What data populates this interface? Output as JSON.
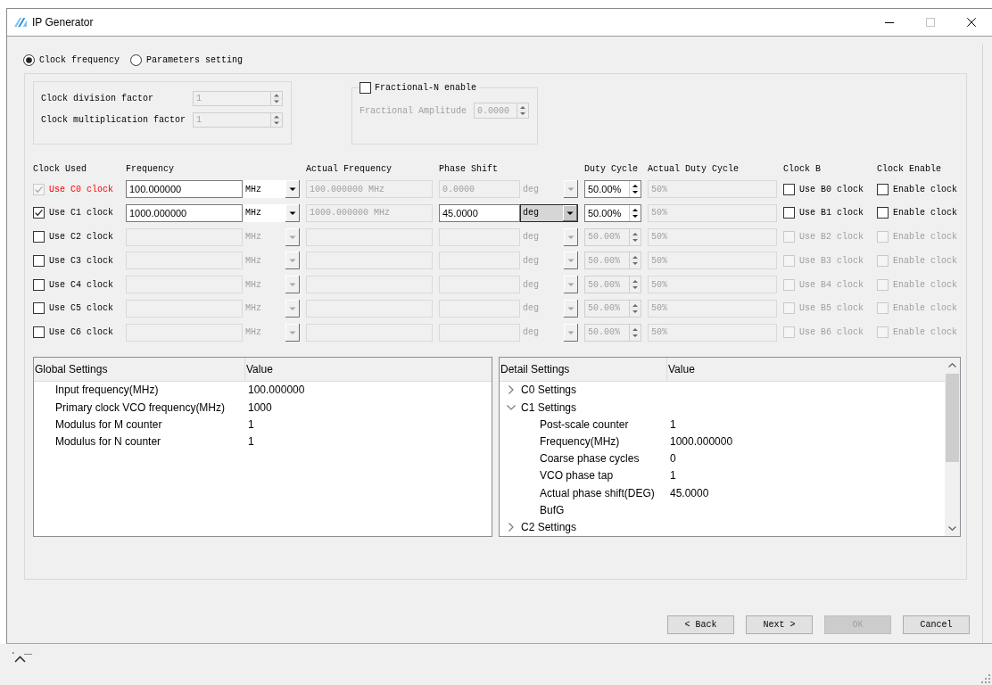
{
  "window": {
    "title": "IP Generator",
    "can_maximize": false
  },
  "mode_options": [
    {
      "label": "Clock frequency",
      "selected": true
    },
    {
      "label": "Parameters setting",
      "selected": false
    }
  ],
  "factor_group": {
    "fields": [
      {
        "label": "Clock division factor",
        "value": "1",
        "disabled": true
      },
      {
        "label": "Clock multiplication factor",
        "value": "1",
        "disabled": true
      }
    ]
  },
  "fractional_n": {
    "label": "Fractional-N enable",
    "checked": false,
    "amplitude": {
      "label": "Fractional Amplitude",
      "value": "0.0000",
      "disabled": true
    }
  },
  "clock_table": {
    "columns": [
      "Clock Used",
      "Frequency",
      "Actual Frequency",
      "Phase Shift",
      "Duty Cycle",
      "Actual Duty Cycle",
      "Clock B",
      "Clock Enable"
    ],
    "rows": [
      {
        "use": {
          "label": "Use C0 clock",
          "checked": true,
          "disabled": true,
          "highlighted": true
        },
        "frequency": {
          "value": "100.000000",
          "disabled": false
        },
        "frequency_unit": {
          "value": "MHz",
          "disabled": false,
          "focused": false
        },
        "actual_frequency": "100.000000 MHz",
        "phase_shift": {
          "value": "0.0000",
          "disabled": true
        },
        "phase_unit": {
          "value": "deg",
          "disabled": true,
          "focused": false
        },
        "duty_cycle": {
          "value": "50.00%",
          "disabled": false
        },
        "actual_duty_cycle": "50%",
        "clock_b": {
          "label": "Use B0 clock",
          "checked": false,
          "disabled": false
        },
        "clock_enable": {
          "label": "Enable clock",
          "checked": false,
          "disabled": false
        }
      },
      {
        "use": {
          "label": "Use C1 clock",
          "checked": true,
          "disabled": false,
          "highlighted": false
        },
        "frequency": {
          "value": "1000.000000",
          "disabled": false
        },
        "frequency_unit": {
          "value": "MHz",
          "disabled": false,
          "focused": false
        },
        "actual_frequency": "1000.000000 MHz",
        "phase_shift": {
          "value": "45.0000",
          "disabled": false
        },
        "phase_unit": {
          "value": "deg",
          "disabled": false,
          "focused": true
        },
        "duty_cycle": {
          "value": "50.00%",
          "disabled": false
        },
        "actual_duty_cycle": "50%",
        "clock_b": {
          "label": "Use B1 clock",
          "checked": false,
          "disabled": false
        },
        "clock_enable": {
          "label": "Enable clock",
          "checked": false,
          "disabled": false
        }
      },
      {
        "use": {
          "label": "Use C2 clock",
          "checked": false,
          "disabled": false,
          "highlighted": false
        },
        "frequency": {
          "disabled": true
        },
        "frequency_unit": {
          "value": "MHz",
          "disabled": true,
          "focused": false
        },
        "phase_shift": {
          "disabled": true
        },
        "phase_unit": {
          "value": "deg",
          "disabled": true,
          "focused": false
        },
        "duty_cycle": {
          "value": "50.00%",
          "disabled": true
        },
        "actual_duty_cycle": "50%",
        "clock_b": {
          "label": "Use B2 clock",
          "checked": false,
          "disabled": true
        },
        "clock_enable": {
          "label": "Enable clock",
          "checked": false,
          "disabled": true
        }
      },
      {
        "use": {
          "label": "Use C3 clock",
          "checked": false,
          "disabled": false,
          "highlighted": false
        },
        "frequency": {
          "disabled": true
        },
        "frequency_unit": {
          "value": "MHz",
          "disabled": true,
          "focused": false
        },
        "phase_shift": {
          "disabled": true
        },
        "phase_unit": {
          "value": "deg",
          "disabled": true,
          "focused": false
        },
        "duty_cycle": {
          "value": "50.00%",
          "disabled": true
        },
        "actual_duty_cycle": "50%",
        "clock_b": {
          "label": "Use B3 clock",
          "checked": false,
          "disabled": true
        },
        "clock_enable": {
          "label": "Enable clock",
          "checked": false,
          "disabled": true
        }
      },
      {
        "use": {
          "label": "Use C4 clock",
          "checked": false,
          "disabled": false,
          "highlighted": false
        },
        "frequency": {
          "disabled": true
        },
        "frequency_unit": {
          "value": "MHz",
          "disabled": true,
          "focused": false
        },
        "phase_shift": {
          "disabled": true
        },
        "phase_unit": {
          "value": "deg",
          "disabled": true,
          "focused": false
        },
        "duty_cycle": {
          "value": "50.00%",
          "disabled": true
        },
        "actual_duty_cycle": "50%",
        "clock_b": {
          "label": "Use B4 clock",
          "checked": false,
          "disabled": true
        },
        "clock_enable": {
          "label": "Enable clock",
          "checked": false,
          "disabled": true
        }
      },
      {
        "use": {
          "label": "Use C5 clock",
          "checked": false,
          "disabled": false,
          "highlighted": false
        },
        "frequency": {
          "disabled": true
        },
        "frequency_unit": {
          "value": "MHz",
          "disabled": true,
          "focused": false
        },
        "phase_shift": {
          "disabled": true
        },
        "phase_unit": {
          "value": "deg",
          "disabled": true,
          "focused": false
        },
        "duty_cycle": {
          "value": "50.00%",
          "disabled": true
        },
        "actual_duty_cycle": "50%",
        "clock_b": {
          "label": "Use B5 clock",
          "checked": false,
          "disabled": true
        },
        "clock_enable": {
          "label": "Enable clock",
          "checked": false,
          "disabled": true
        }
      },
      {
        "use": {
          "label": "Use C6 clock",
          "checked": false,
          "disabled": false,
          "highlighted": false
        },
        "frequency": {
          "disabled": true
        },
        "frequency_unit": {
          "value": "MHz",
          "disabled": true,
          "focused": false
        },
        "phase_shift": {
          "disabled": true
        },
        "phase_unit": {
          "value": "deg",
          "disabled": true,
          "focused": false
        },
        "duty_cycle": {
          "value": "50.00%",
          "disabled": true
        },
        "actual_duty_cycle": "50%",
        "clock_b": {
          "label": "Use B6 clock",
          "checked": false,
          "disabled": true
        },
        "clock_enable": {
          "label": "Enable clock",
          "checked": false,
          "disabled": true
        }
      }
    ]
  },
  "global_settings": {
    "columns": [
      "Global Settings",
      "Value"
    ],
    "items": [
      {
        "label": "Input frequency(MHz)",
        "value": "100.000000"
      },
      {
        "label": "Primary clock VCO frequency(MHz)",
        "value": "1000"
      },
      {
        "label": "Modulus for M counter",
        "value": "1"
      },
      {
        "label": "Modulus for N counter",
        "value": "1"
      }
    ]
  },
  "detail_settings": {
    "columns": [
      "Detail Settings",
      "Value"
    ],
    "items": [
      {
        "label": "C0 Settings",
        "expanded": false
      },
      {
        "label": "C1 Settings",
        "expanded": true,
        "children": [
          {
            "label": "Post-scale counter",
            "value": "1"
          },
          {
            "label": "Frequency(MHz)",
            "value": "1000.000000"
          },
          {
            "label": "Coarse phase cycles",
            "value": "0"
          },
          {
            "label": "VCO phase tap",
            "value": "1"
          },
          {
            "label": "Actual phase shift(DEG)",
            "value": "45.0000"
          },
          {
            "label": "BufG"
          }
        ]
      },
      {
        "label": "C2 Settings",
        "expanded": false
      }
    ]
  },
  "buttons": [
    {
      "label": "< Back",
      "disabled": false
    },
    {
      "label": "Next >",
      "disabled": false
    },
    {
      "label": "OK",
      "disabled": true
    },
    {
      "label": "Cancel",
      "disabled": false
    }
  ]
}
